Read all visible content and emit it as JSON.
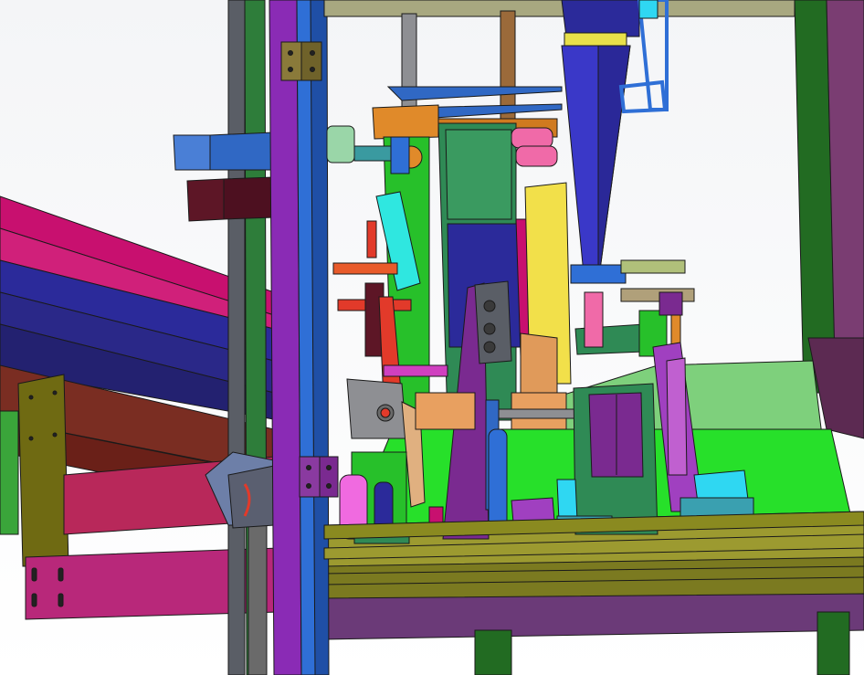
{
  "scene": {
    "colors": {
      "background_top": "#f4f5f7",
      "background_bottom": "#ffffff",
      "frame_purple": "#8a2bb5",
      "frame_blue": "#2f6fd6",
      "frame_olive": "#6f6a12",
      "deck_green": "#27e02a",
      "chute_magenta": "#c8106f",
      "chute_navy": "#2b2a9a",
      "beam_brown": "#7a2d22",
      "column_dark_green": "#226b22",
      "mechanism_green": "#2f8a55",
      "cyan_block": "#2fd7f2",
      "yellow_part": "#f2e04a",
      "orange_part": "#e08a2a",
      "red_rod": "#e23a2a",
      "pink_part": "#f06aa8",
      "gray_part": "#8e8f93",
      "maroon_part": "#5d1626"
    }
  }
}
